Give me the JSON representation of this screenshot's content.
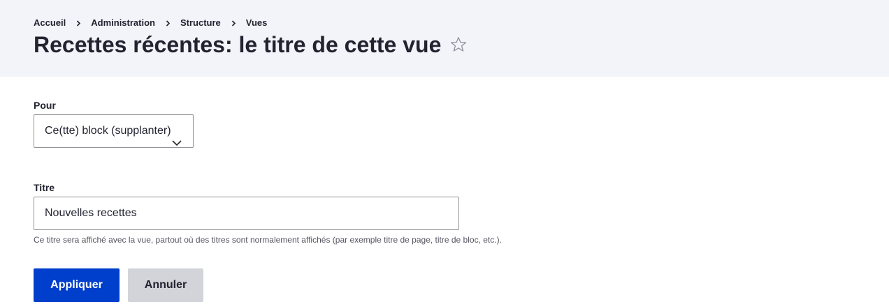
{
  "breadcrumb": {
    "items": [
      "Accueil",
      "Administration",
      "Structure",
      "Vues"
    ]
  },
  "header": {
    "title": "Recettes récentes: le titre de cette vue",
    "star_icon": "star-outline-icon"
  },
  "form": {
    "for_label": "Pour",
    "for_selected": "Ce(tte) block (supplanter)",
    "title_label": "Titre",
    "title_value": "Nouvelles recettes",
    "title_description": "Ce titre sera affiché avec la vue, partout où des titres sont normalement affichés (par exemple titre de page, titre de bloc, etc.)."
  },
  "actions": {
    "apply_label": "Appliquer",
    "cancel_label": "Annuler"
  },
  "colors": {
    "header_bg": "#f3f4f9",
    "primary": "#003ecc",
    "secondary": "#d3d4d9"
  }
}
